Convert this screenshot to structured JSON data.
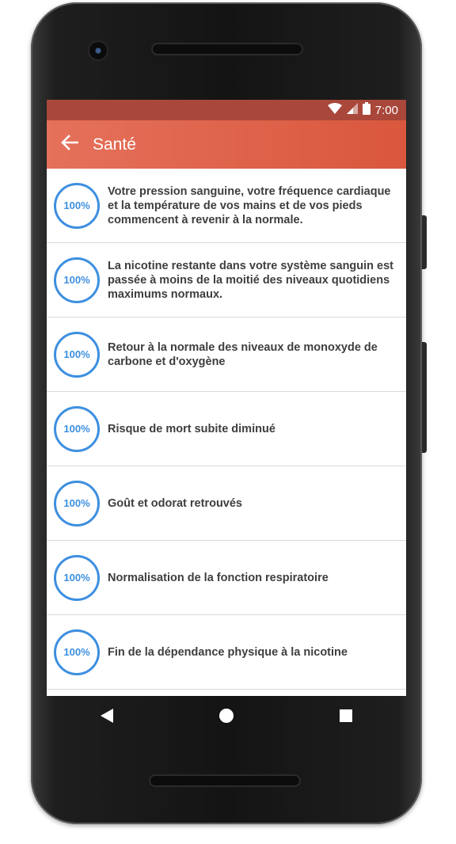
{
  "status": {
    "time": "7:00"
  },
  "appbar": {
    "title": "Santé"
  },
  "items": [
    {
      "percent": "100%",
      "text": "Votre pression sanguine, votre fréquence cardiaque et la température de vos mains et de vos pieds commencent à revenir à la normale."
    },
    {
      "percent": "100%",
      "text": "La nicotine restante dans votre système sanguin est passée à moins de la moitié des niveaux quotidiens maximums normaux."
    },
    {
      "percent": "100%",
      "text": "Retour à la normale des niveaux de monoxyde de carbone et d'oxygène"
    },
    {
      "percent": "100%",
      "text": "Risque de mort subite diminué"
    },
    {
      "percent": "100%",
      "text": "Goût et odorat retrouvés"
    },
    {
      "percent": "100%",
      "text": "Normalisation de la fonction respiratoire"
    },
    {
      "percent": "100%",
      "text": "Fin de la dépendance physique à la nicotine"
    }
  ],
  "icons": {
    "back": "arrow-left-icon",
    "wifi": "wifi-icon",
    "signal": "cell-signal-icon",
    "battery": "battery-icon",
    "nav_back": "triangle-back-icon",
    "nav_home": "circle-home-icon",
    "nav_recents": "square-recents-icon"
  },
  "colors": {
    "statusbar": "#a9473b",
    "appbar": "#dd5f45",
    "ring": "#3d8fe0",
    "text": "#3e3e3e"
  }
}
